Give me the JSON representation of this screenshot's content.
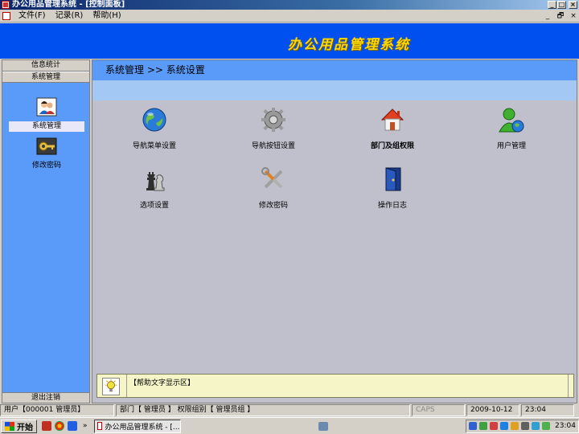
{
  "window": {
    "title": "办公用品管理系统 - [控制面板]",
    "buttons": [
      "_",
      "□",
      "×"
    ]
  },
  "menubar": {
    "items": [
      "文件(F)",
      "记录(R)",
      "帮助(H)"
    ],
    "mdi_buttons": [
      "_",
      "🗗",
      "×"
    ]
  },
  "banner": {
    "title": "办公用品管理系统"
  },
  "sidebar": {
    "sections": [
      "信息统计",
      "系统管理"
    ],
    "items": [
      {
        "label": "系统管理",
        "icon": "admin-users-icon",
        "selected": true
      },
      {
        "label": "修改密码",
        "icon": "key-icon",
        "selected": false
      }
    ],
    "logout": "退出注销"
  },
  "main": {
    "breadcrumb": "系统管理  >>  系统设置",
    "tiles": [
      {
        "label": "导航菜单设置",
        "icon": "globe-icon"
      },
      {
        "label": "导航按钮设置",
        "icon": "gear-icon"
      },
      {
        "label": "部门及组权限",
        "icon": "house-icon"
      },
      {
        "label": "用户管理",
        "icon": "user-globe-icon"
      },
      {
        "label": "选项设置",
        "icon": "chess-icon"
      },
      {
        "label": "修改密码",
        "icon": "tools-icon"
      },
      {
        "label": "操作日志",
        "icon": "door-icon"
      }
    ],
    "help_text": "【帮助文字显示区】"
  },
  "statusbar": {
    "user": "用户【000001 管理员】",
    "dept": "部门【 管理员 】 权限组别【 管理员组 】",
    "caps": "CAPS",
    "date": "2009-10-12",
    "time": "23:04"
  },
  "taskbar": {
    "start": "开始",
    "chevron": "»",
    "task": "办公用品管理系统 - [...",
    "clock": "23:04"
  },
  "colors": {
    "banner": "#0050f0",
    "banner_title": "#ffd800",
    "sidebar": "#5a9af8",
    "main_bg": "#c0c0cc"
  }
}
